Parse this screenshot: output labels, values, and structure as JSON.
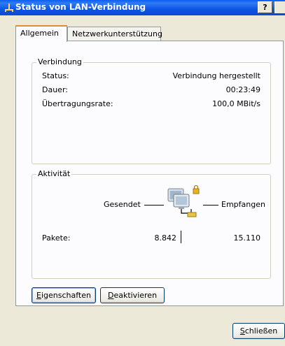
{
  "window": {
    "title": "Status von LAN-Verbindung",
    "help_label": "?"
  },
  "tabs": [
    {
      "label": "Allgemein",
      "active": true
    },
    {
      "label": "Netzwerkunterstützung",
      "active": false
    }
  ],
  "connection": {
    "legend": "Verbindung",
    "rows": [
      {
        "label": "Status:",
        "value": "Verbindung hergestellt"
      },
      {
        "label": "Dauer:",
        "value": "00:23:49"
      },
      {
        "label": "Übertragungsrate:",
        "value": "100,0 MBit/s"
      }
    ]
  },
  "activity": {
    "legend": "Aktivität",
    "sent_label": "Gesendet",
    "received_label": "Empfangen",
    "packets_label": "Pakete:",
    "packets_sent": "8.842",
    "packets_received": "15.110",
    "icon": "network-computers-icon"
  },
  "buttons": {
    "properties_label_pre": "",
    "properties_label_ul": "E",
    "properties_label_post": "igenschaften",
    "disable_label_pre": "",
    "disable_label_ul": "D",
    "disable_label_post": "eaktivieren",
    "close_label_pre": "",
    "close_label_ul": "S",
    "close_label_post": "chließen"
  },
  "colors": {
    "titlebar": "#0a5ef3",
    "dialog_bg": "#ece9d8",
    "tab_accent": "#e68b2c"
  }
}
